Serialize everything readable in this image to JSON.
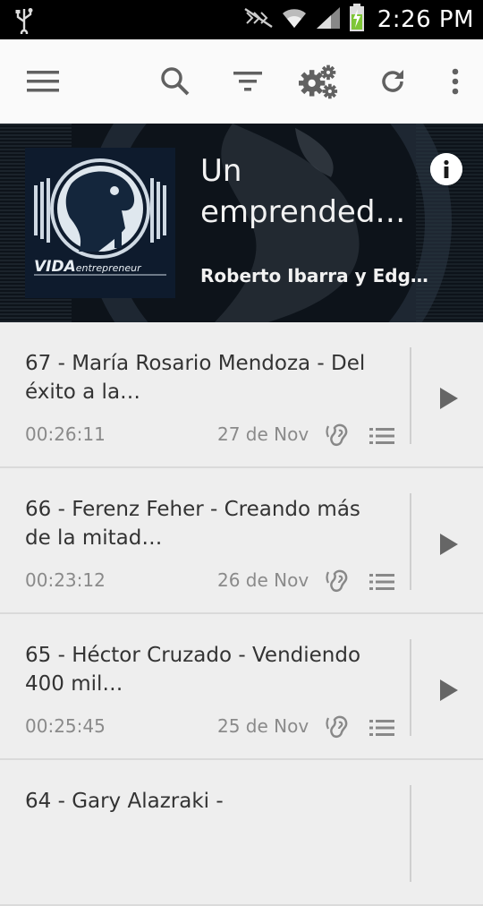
{
  "status_bar": {
    "time": "2:26 PM",
    "icons": [
      "usb-icon",
      "mute-icon",
      "wifi-icon",
      "signal-icon",
      "battery-charging-icon"
    ]
  },
  "toolbar": {
    "icons": [
      "menu-icon",
      "search-icon",
      "filter-icon",
      "settings-icon",
      "refresh-icon",
      "more-vert-icon"
    ]
  },
  "podcast": {
    "title": "Un emprended…",
    "author": "Roberto Ibarra y Edgar…",
    "cover_logo_text": "VIDA entrepreneur",
    "info_icon": "info-icon"
  },
  "episodes": [
    {
      "title": "67 - María Rosario Mendoza - Del éxito a la…",
      "duration": "00:26:11",
      "date": "27 de Nov"
    },
    {
      "title": "66 - Ferenz Feher - Creando más de la mitad…",
      "duration": "00:23:12",
      "date": "26 de Nov"
    },
    {
      "title": "65 - Héctor Cruzado - Vendiendo 400 mil…",
      "duration": "00:25:45",
      "date": "25 de Nov"
    },
    {
      "title": "64 - Gary Alazraki -",
      "duration": "",
      "date": ""
    }
  ],
  "colors": {
    "toolbar_bg": "#fafafa",
    "list_bg": "#eeeeee",
    "icon_gray": "#616161",
    "banner_bg": "#0d131b"
  }
}
